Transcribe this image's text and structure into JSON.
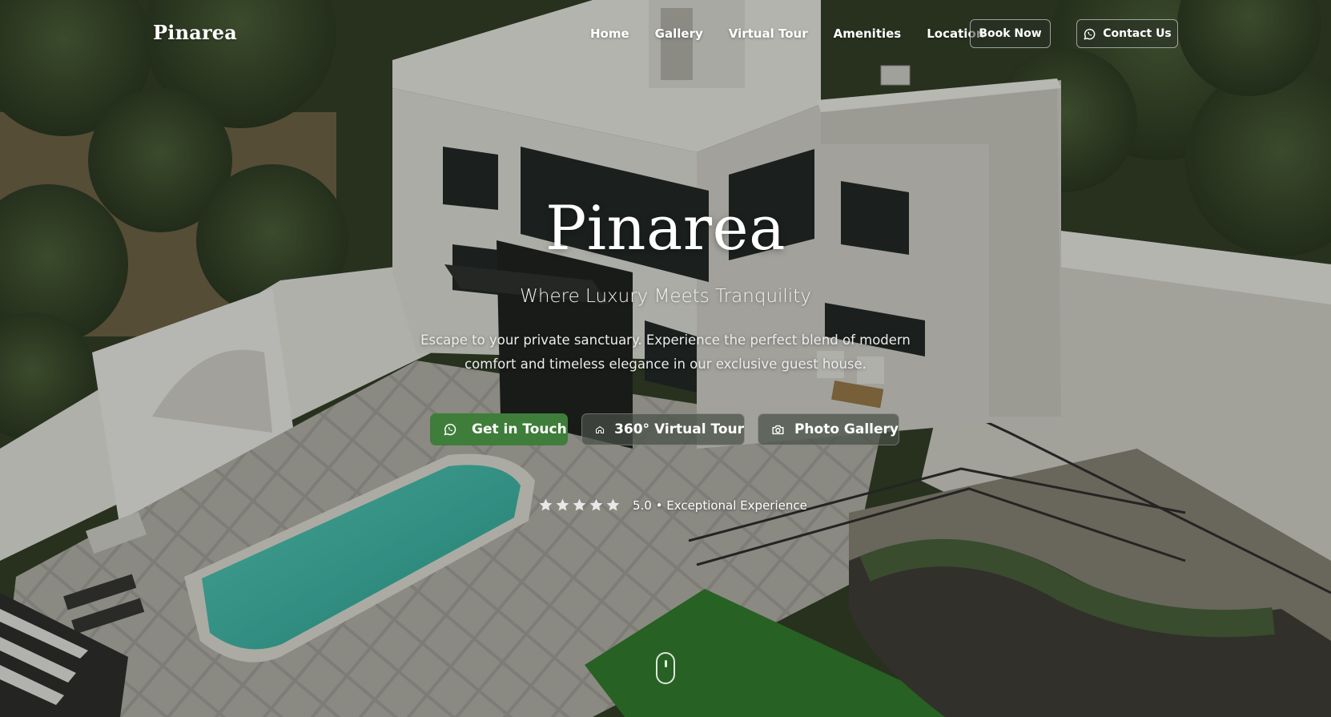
{
  "nav": {
    "brand": "Pinarea",
    "links": [
      {
        "label": "Home"
      },
      {
        "label": "Gallery"
      },
      {
        "label": "Virtual Tour"
      },
      {
        "label": "Amenities"
      },
      {
        "label": "Location"
      }
    ],
    "book_button": "Book Now",
    "contact_button": "Contact Us",
    "contact_icon": "whatsapp-icon"
  },
  "hero": {
    "title": "Pinarea",
    "subtitle": "Where Luxury Meets Tranquility",
    "description": "Escape to your private sanctuary. Experience the perfect blend of modern comfort and timeless elegance in our exclusive guest house.",
    "buttons": {
      "touch": {
        "label": "Get in Touch",
        "icon": "whatsapp-icon"
      },
      "tour": {
        "label": "360° Virtual Tour",
        "icon": "home-icon"
      },
      "gallery": {
        "label": "Photo Gallery",
        "icon": "camera-icon"
      }
    },
    "rating": {
      "stars": 5,
      "text": "5.0 • Exceptional Experience"
    },
    "scroll_icon": "mouse-scroll-icon"
  },
  "colors": {
    "accent_green": "#3f7d3a",
    "pool": "#3fc9b5",
    "lawn": "#2f7d2a"
  }
}
